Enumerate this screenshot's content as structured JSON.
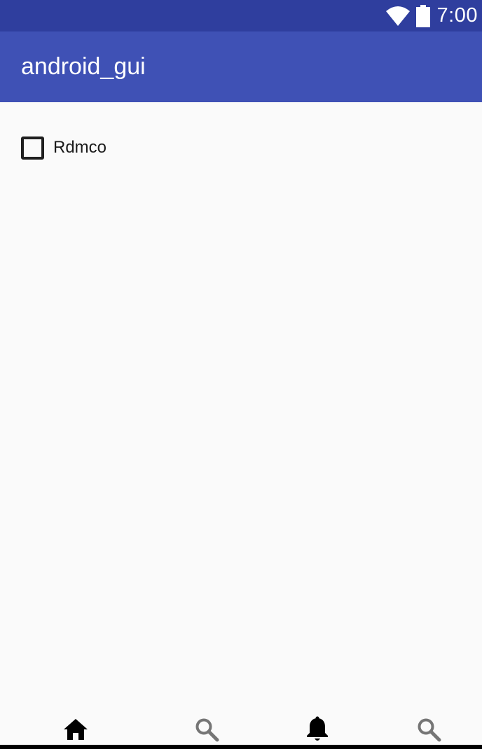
{
  "status_bar": {
    "time": "7:00",
    "wifi_icon": "wifi-icon",
    "battery_icon": "battery-icon"
  },
  "app_bar": {
    "title": "android_gui"
  },
  "content": {
    "checkbox": {
      "label": "Rdmco",
      "checked": false
    }
  },
  "bottom_nav": {
    "items": [
      {
        "icon": "home-icon",
        "active": true
      },
      {
        "icon": "search-icon",
        "active": false
      },
      {
        "icon": "bell-icon",
        "active": true
      },
      {
        "icon": "search-icon",
        "active": false
      }
    ]
  },
  "colors": {
    "status_bar": "#2f3e9e",
    "app_bar": "#3f51b5",
    "background": "#fafafa",
    "active_icon": "#000000",
    "inactive_icon": "#757575"
  }
}
